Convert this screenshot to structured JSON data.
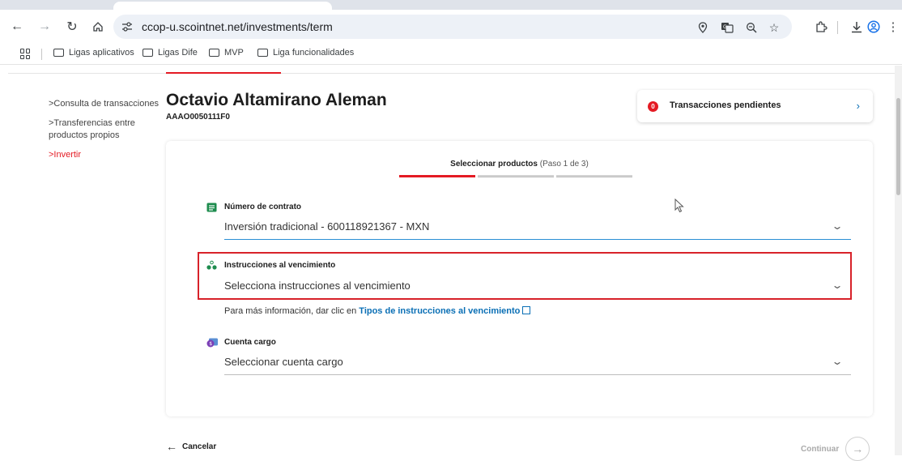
{
  "browser": {
    "url": "ccop-u.scointnet.net/investments/term",
    "icons": [
      "back-icon",
      "forward-icon",
      "reload-icon",
      "home-icon",
      "site-settings-icon",
      "location-icon",
      "translate-icon",
      "zoom-icon",
      "star-icon",
      "extensions-icon",
      "download-icon",
      "profile-icon",
      "menu-icon"
    ]
  },
  "bookmarks": [
    {
      "label": "Ligas aplicativos"
    },
    {
      "label": "Ligas Dife"
    },
    {
      "label": "MVP"
    },
    {
      "label": "Liga funcionalidades"
    }
  ],
  "sidebar": {
    "items": [
      {
        "label": ">Consulta de transacciones",
        "active": false
      },
      {
        "label": ">Transferencias entre productos propios",
        "active": false
      },
      {
        "label": ">Invertir",
        "active": true
      }
    ]
  },
  "client": {
    "name": "Octavio Altamirano Aleman",
    "code": "AAAO0050111F0"
  },
  "pending": {
    "count": "0",
    "label": "Transacciones pendientes"
  },
  "steps": {
    "title": "Seleccionar productos",
    "progress": "(Paso 1 de 3)",
    "current": 1,
    "total": 3
  },
  "form": {
    "contract": {
      "label": "Número de contrato",
      "value": "Inversión tradicional - 600118921367 - MXN"
    },
    "instructions": {
      "label": "Instrucciones al vencimiento",
      "placeholder": "Selecciona instrucciones al vencimiento"
    },
    "help": {
      "text": "Para más información, dar clic en ",
      "link": "Tipos de instrucciones al vencimiento"
    },
    "account": {
      "label": "Cuenta cargo",
      "placeholder": "Seleccionar cuenta cargo"
    }
  },
  "actions": {
    "cancel": "Cancelar",
    "continue": "Continuar"
  },
  "colors": {
    "brand_red": "#e41a23",
    "link_blue": "#0a6fb5"
  }
}
